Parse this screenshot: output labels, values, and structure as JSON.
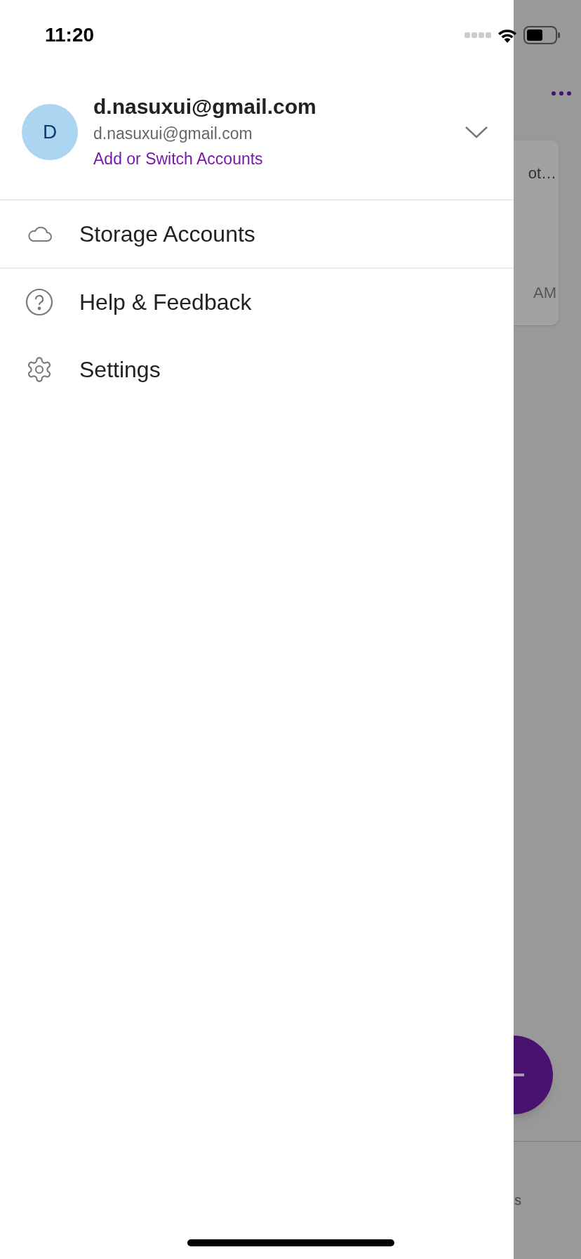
{
  "status_bar": {
    "time": "11:20"
  },
  "account": {
    "initial": "D",
    "name": "d.nasuxui@gmail.com",
    "email": "d.nasuxui@gmail.com",
    "link": "Add or Switch Accounts",
    "expanded": false
  },
  "menu": [
    {
      "kind": "cloud",
      "label": "Storage Accounts",
      "divider_after": true
    },
    {
      "kind": "help",
      "label": "Help & Feedback",
      "divider_after": false
    },
    {
      "kind": "gear",
      "label": "Settings",
      "divider_after": false
    }
  ],
  "background": {
    "card_text": "ot…",
    "card_time": "AM",
    "tab_label": "s"
  }
}
